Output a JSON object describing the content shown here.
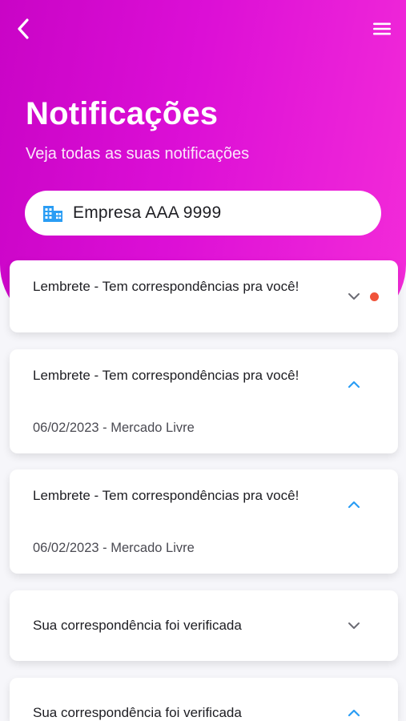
{
  "header": {
    "title": "Notificações",
    "subtitle": "Veja todas as suas notificações",
    "back_icon": "chevron-left-icon",
    "menu_icon": "hamburger-menu-icon"
  },
  "company": {
    "icon": "building-icon",
    "name": "Empresa AAA 9999"
  },
  "notifications": [
    {
      "title": "Lembrete - Tem correspondências pra você!",
      "meta": "",
      "expanded": false,
      "unread": true
    },
    {
      "title": "Lembrete - Tem correspondências pra você!",
      "meta": "06/02/2023 - Mercado Livre",
      "expanded": true,
      "unread": false
    },
    {
      "title": "Lembrete - Tem correspondências pra você!",
      "meta": "06/02/2023 - Mercado Livre",
      "expanded": true,
      "unread": false
    },
    {
      "title": "Sua correspondência foi verificada",
      "meta": "",
      "expanded": false,
      "unread": false
    },
    {
      "title": "Sua correspondência foi verificada",
      "meta": "",
      "expanded": true,
      "unread": false
    }
  ],
  "colors": {
    "gradient_start": "#c904c6",
    "gradient_end": "#f32bd9",
    "accent_blue": "#2a9df4",
    "unread_dot": "#f0533a",
    "chevron_gray": "#6b6b73"
  }
}
